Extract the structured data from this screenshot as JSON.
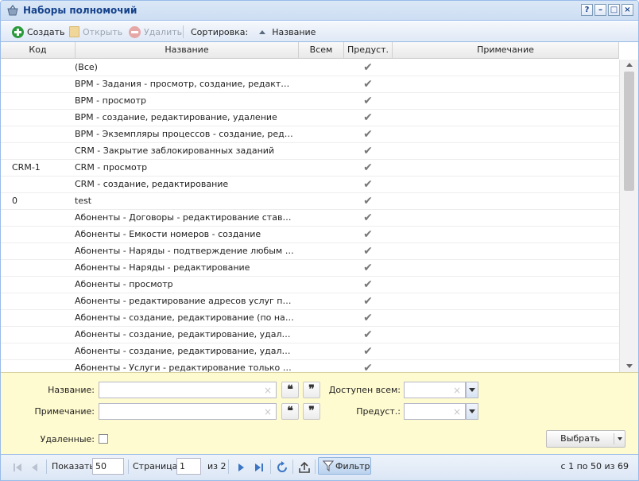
{
  "window": {
    "title": "Наборы полномочий",
    "tools": [
      "?",
      "–",
      "□",
      "×"
    ]
  },
  "toolbar": {
    "create": "Создать",
    "open": "Открыть",
    "delete": "Удалить",
    "sort_label": "Сортировка:",
    "sort_value": "Название"
  },
  "grid": {
    "columns": {
      "code": "Код",
      "name": "Название",
      "all": "Всем",
      "pred": "Предуст.",
      "note": "Примечание"
    },
    "rows": [
      {
        "code": "",
        "name": "(Все)",
        "pred": "✔"
      },
      {
        "code": "",
        "name": "BPM - Задания - просмотр, создание, редактирован...",
        "pred": "✔"
      },
      {
        "code": "",
        "name": "BPM - просмотр",
        "pred": "✔"
      },
      {
        "code": "",
        "name": "BPM - создание, редактирование, удаление",
        "pred": "✔"
      },
      {
        "code": "",
        "name": "BPM - Экземпляры процессов - создание, редактир...",
        "pred": "✔"
      },
      {
        "code": "",
        "name": "CRM - Закрытие заблокированных заданий",
        "pred": "✔"
      },
      {
        "code": "CRM-1",
        "name": "CRM - просмотр",
        "pred": "✔"
      },
      {
        "code": "",
        "name": "CRM - создание, редактирование",
        "pred": "✔"
      },
      {
        "code": "0",
        "name": "test",
        "pred": "✔"
      },
      {
        "code": "",
        "name": "Абоненты - Договоры - редактирование ставки НДС",
        "pred": "✔"
      },
      {
        "code": "",
        "name": "Абоненты - Емкости номеров - создание",
        "pred": "✔"
      },
      {
        "code": "",
        "name": "Абоненты - Наряды - подтверждение любым числом",
        "pred": "✔"
      },
      {
        "code": "",
        "name": "Абоненты - Наряды - редактирование",
        "pred": "✔"
      },
      {
        "code": "",
        "name": "Абоненты - просмотр",
        "pred": "✔"
      },
      {
        "code": "",
        "name": "Абоненты - редактирование адресов услуг по корр...",
        "pred": "✔"
      },
      {
        "code": "",
        "name": "Абоненты - создание, редактирование (по наряду)",
        "pred": "✔"
      },
      {
        "code": "",
        "name": "Абоненты - создание, редактирование, удаление (п...",
        "pred": "✔"
      },
      {
        "code": "",
        "name": "Абоненты - создание, редактирование, удаление (п...",
        "pred": "✔"
      },
      {
        "code": "",
        "name": "Абоненты - Услуги - редактирование только технич...",
        "pred": "✔"
      }
    ]
  },
  "filter": {
    "name_label": "Название:",
    "note_label": "Примечание:",
    "all_label": "Доступен всем:",
    "pred_label": "Предуст.:",
    "deleted_label": "Удаленные:",
    "select_button": "Выбрать",
    "clear_glyph": "×",
    "quote_open": "❝",
    "quote_close": "❞"
  },
  "pager": {
    "show_label": "Показать",
    "page_size": "50",
    "page_label": "Страница",
    "page": "1",
    "of_pages": "из 2",
    "filter_button": "Фильтр",
    "summary": "с 1 по 50 из 69"
  }
}
